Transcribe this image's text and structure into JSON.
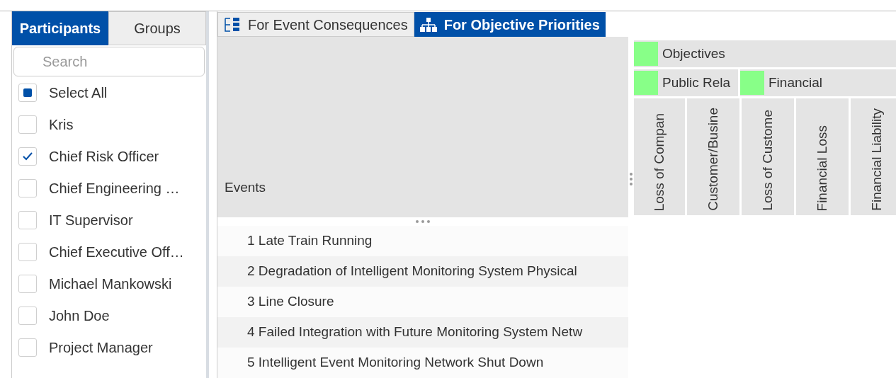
{
  "left_tabs": [
    {
      "label": "Participants",
      "selected": true
    },
    {
      "label": "Groups",
      "selected": false
    }
  ],
  "search": {
    "placeholder": "Search"
  },
  "participants": [
    {
      "label": "Select All",
      "checked": false,
      "indeterminate": true
    },
    {
      "label": "Kris",
      "checked": false,
      "indeterminate": false
    },
    {
      "label": "Chief Risk Officer",
      "checked": true,
      "indeterminate": false
    },
    {
      "label": "Chief Engineering …",
      "checked": false,
      "indeterminate": false
    },
    {
      "label": "IT Supervisor",
      "checked": false,
      "indeterminate": false
    },
    {
      "label": "Chief Executive Off…",
      "checked": false,
      "indeterminate": false
    },
    {
      "label": "Michael Mankowski",
      "checked": false,
      "indeterminate": false
    },
    {
      "label": "John Doe",
      "checked": false,
      "indeterminate": false
    },
    {
      "label": "Project Manager",
      "checked": false,
      "indeterminate": false
    }
  ],
  "main_tabs": [
    {
      "label": "For Event Consequences",
      "kind": "list",
      "selected": false
    },
    {
      "label": "For Objective Priorities",
      "kind": "tree",
      "selected": true
    }
  ],
  "events_header": "Events",
  "events": [
    "1 Late Train Running",
    "2 Degradation of Intelligent Monitoring System Physical",
    "3 Line Closure",
    "4 Failed Integration with Future Monitoring System Netw",
    "5 Intelligent Event Monitoring Network Shut Down"
  ],
  "objectives": {
    "label": "Objectives",
    "color": "#88ff88",
    "groups": [
      {
        "label": "Public Rela",
        "color": "#88ff88",
        "columns": [
          "Loss of Compan",
          "Customer/Busine"
        ]
      },
      {
        "label": "Financial",
        "color": "#88ff88",
        "columns": [
          "Loss of Custome",
          "Financial Loss",
          "Financial Liability"
        ]
      }
    ]
  }
}
